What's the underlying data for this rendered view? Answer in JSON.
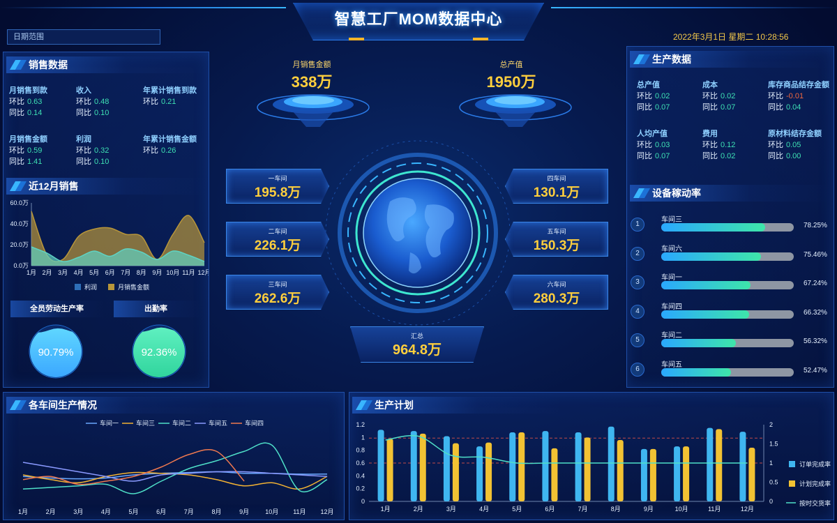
{
  "header": {
    "title": "智慧工厂MOM数据中心",
    "date_range_label": "日期范围",
    "datetime": "2022年3月1日 星期二    10:28:56"
  },
  "colors": {
    "accent_gold": "#ffcf3d",
    "accent_cyan": "#39b6ff",
    "positive": "#3ee0b3",
    "negative": "#f2683d"
  },
  "sales": {
    "title": "销售数据",
    "items": [
      {
        "label": "月销售到款",
        "lines": [
          [
            "环比",
            "0.63"
          ],
          [
            "同比",
            "0.14"
          ]
        ]
      },
      {
        "label": "收入",
        "lines": [
          [
            "环比",
            "0.48"
          ],
          [
            "同比",
            "0.10"
          ]
        ]
      },
      {
        "label": "年累计销售到款",
        "lines": [
          [
            "环比",
            "0.21"
          ]
        ]
      },
      {
        "label": "月销售金额",
        "lines": [
          [
            "环比",
            "0.59"
          ],
          [
            "同比",
            "1.41"
          ]
        ]
      },
      {
        "label": "利润",
        "lines": [
          [
            "环比",
            "0.32"
          ],
          [
            "同比",
            "0.10"
          ]
        ]
      },
      {
        "label": "年累计销售金额",
        "lines": [
          [
            "环比",
            "0.26"
          ]
        ]
      }
    ]
  },
  "last12": {
    "title": "近12月销售",
    "legend": [
      "利润",
      "月销售金额"
    ]
  },
  "rates": {
    "labor_title": "全员劳动生产率",
    "labor_value": "90.79%",
    "labor_fraction": 0.9079,
    "attendance_title": "出勤率",
    "attendance_value": "92.36%",
    "attendance_fraction": 0.9236
  },
  "center": {
    "monthly_sales_label": "月销售金额",
    "monthly_sales_value": "338万",
    "total_output_label": "总产值",
    "total_output_value": "1950万",
    "workshops": [
      {
        "name": "一车间",
        "value": "195.8万"
      },
      {
        "name": "二车间",
        "value": "226.1万"
      },
      {
        "name": "三车间",
        "value": "262.6万"
      },
      {
        "name": "四车间",
        "value": "130.1万"
      },
      {
        "name": "五车间",
        "value": "150.3万"
      },
      {
        "name": "六车间",
        "value": "280.3万"
      }
    ],
    "summary_label": "汇总",
    "summary_value": "964.8万"
  },
  "production": {
    "title": "生产数据",
    "items": [
      {
        "label": "总产值",
        "lines": [
          [
            "环比",
            "0.02",
            "pos"
          ],
          [
            "同比",
            "0.07",
            "pos"
          ]
        ]
      },
      {
        "label": "成本",
        "lines": [
          [
            "环比",
            "0.02",
            "pos"
          ],
          [
            "同比",
            "0.07",
            "pos"
          ]
        ]
      },
      {
        "label": "库存商品结存金额",
        "lines": [
          [
            "环比",
            "-0.01",
            "neg"
          ],
          [
            "同比",
            "0.04",
            "pos"
          ]
        ]
      },
      {
        "label": "人均产值",
        "lines": [
          [
            "环比",
            "0.03",
            "pos"
          ],
          [
            "同比",
            "0.07",
            "pos"
          ]
        ]
      },
      {
        "label": "费用",
        "lines": [
          [
            "环比",
            "0.12",
            "pos"
          ],
          [
            "同比",
            "0.02",
            "pos"
          ]
        ]
      },
      {
        "label": "原材料结存金额",
        "lines": [
          [
            "环比",
            "0.05",
            "pos"
          ],
          [
            "同比",
            "0.00",
            "pos"
          ]
        ]
      }
    ]
  },
  "utilization": {
    "title": "设备稼动率",
    "rows": [
      {
        "rank": "1",
        "name": "车间三",
        "pct": "78.25%",
        "fraction": 0.7825
      },
      {
        "rank": "2",
        "name": "车间六",
        "pct": "75.46%",
        "fraction": 0.7546
      },
      {
        "rank": "3",
        "name": "车间一",
        "pct": "67.24%",
        "fraction": 0.6724
      },
      {
        "rank": "4",
        "name": "车间四",
        "pct": "66.32%",
        "fraction": 0.6632
      },
      {
        "rank": "5",
        "name": "车间二",
        "pct": "56.32%",
        "fraction": 0.5632
      },
      {
        "rank": "6",
        "name": "车间五",
        "pct": "52.47%",
        "fraction": 0.5247
      }
    ]
  },
  "workshop_prod": {
    "title": "各车间生产情况"
  },
  "plan": {
    "title": "生产计划"
  },
  "chart_data": [
    {
      "type": "area",
      "categories": [
        "1月",
        "2月",
        "3月",
        "4月",
        "5月",
        "6月",
        "7月",
        "8月",
        "9月",
        "10月",
        "11月",
        "12月"
      ],
      "ylim": [
        0,
        60
      ],
      "yticks": [
        "0.0万",
        "20.0万",
        "40.0万",
        "60.0万"
      ],
      "series": [
        {
          "name": "利润",
          "values": [
            18,
            12,
            4,
            8,
            14,
            9,
            16,
            13,
            6,
            14,
            10,
            4
          ],
          "color": "#5fd3c3"
        },
        {
          "name": "月销售金额",
          "values": [
            52,
            10,
            6,
            28,
            35,
            36,
            30,
            28,
            6,
            30,
            48,
            22
          ],
          "color": "#b8963a"
        }
      ]
    },
    {
      "type": "line",
      "categories": [
        "1月",
        "2月",
        "3月",
        "4月",
        "5月",
        "6月",
        "7月",
        "8月",
        "9月",
        "10月",
        "11月",
        "12月"
      ],
      "series": [
        {
          "name": "车间一",
          "values": [
            30,
            28,
            27,
            28,
            32,
            34,
            35,
            36,
            34,
            34,
            33,
            33
          ],
          "color": "#6aa8ff"
        },
        {
          "name": "车间三",
          "values": [
            32,
            26,
            22,
            30,
            35,
            34,
            32,
            26,
            18,
            22,
            14,
            30
          ],
          "color": "#f2b233"
        },
        {
          "name": "车间二",
          "values": [
            14,
            16,
            18,
            20,
            8,
            24,
            40,
            50,
            62,
            70,
            12,
            26
          ],
          "color": "#4fe0c8"
        },
        {
          "name": "车间五",
          "values": [
            48,
            42,
            36,
            30,
            24,
            32,
            34,
            36,
            36,
            34,
            32,
            30
          ],
          "color": "#8a9aff"
        },
        {
          "name": "车间四",
          "values": [
            26,
            30,
            20,
            24,
            30,
            42,
            58,
            62,
            24,
            null,
            null,
            null
          ],
          "color": "#f0794f"
        }
      ]
    },
    {
      "type": "bar",
      "categories": [
        "1月",
        "2月",
        "3月",
        "4月",
        "5月",
        "6月",
        "7月",
        "8月",
        "9月",
        "10月",
        "11月",
        "12月"
      ],
      "ylim": [
        0,
        1.2
      ],
      "yticks_left": [
        "0",
        "0.2",
        "0.4",
        "0.6",
        "0.8",
        "1",
        "1.2"
      ],
      "y2lim": [
        0,
        2
      ],
      "yticks_right": [
        "0",
        "0.5",
        "1",
        "1.5",
        "2"
      ],
      "series": [
        {
          "name": "订单完成率",
          "values": [
            1.12,
            1.1,
            1.02,
            0.86,
            1.08,
            1.1,
            1.08,
            1.17,
            0.82,
            0.86,
            1.15,
            1.09
          ],
          "color": "#3fb6f0"
        },
        {
          "name": "计划完成率",
          "values": [
            0.98,
            1.06,
            0.91,
            0.92,
            1.08,
            0.83,
            1.0,
            0.96,
            0.82,
            0.86,
            1.13,
            0.84
          ],
          "color": "#f2c233"
        },
        {
          "name": "按时交货率",
          "axis": "right",
          "values": [
            1.6,
            1.7,
            1.2,
            1.15,
            1.0,
            1.0,
            1.0,
            1.0,
            1.0,
            1.0,
            1.0,
            1.0
          ],
          "color": "#4fe0c8"
        }
      ],
      "reference_lines_right": [
        1.0,
        1.65
      ]
    }
  ]
}
